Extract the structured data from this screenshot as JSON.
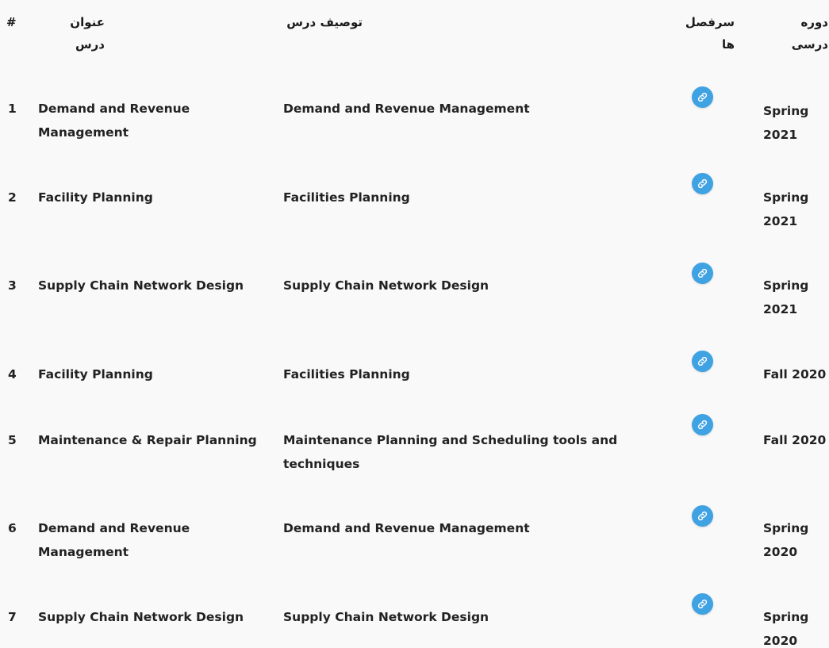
{
  "table": {
    "headers": {
      "num": "#",
      "title": "عنوان درس",
      "description": "توصیف درس",
      "syllabus": "سرفصل ها",
      "term": "دوره درسی"
    },
    "rows": [
      {
        "num": "1",
        "title": "Demand and Revenue Management",
        "description": "Demand and Revenue Management",
        "term": "Spring 2021"
      },
      {
        "num": "2",
        "title": "Facility Planning",
        "description": "Facilities Planning",
        "term": "Spring 2021"
      },
      {
        "num": "3",
        "title": "Supply Chain Network Design",
        "description": "Supply Chain Network Design",
        "term": "Spring 2021"
      },
      {
        "num": "4",
        "title": "Facility Planning",
        "description": "Facilities Planning",
        "term": "Fall 2020"
      },
      {
        "num": "5",
        "title": "Maintenance & Repair Planning",
        "description": "Maintenance Planning and Scheduling tools and techniques",
        "term": "Fall 2020"
      },
      {
        "num": "6",
        "title": "Demand and Revenue Management",
        "description": "Demand and Revenue Management",
        "term": "Spring 2020"
      },
      {
        "num": "7",
        "title": "Supply Chain Network Design",
        "description": "Supply Chain Network Design",
        "term": "Spring 2020"
      }
    ],
    "syllabus_icon": "link-icon"
  },
  "colors": {
    "background": "#f9f9f9",
    "link_button": "#3fa2e3",
    "text": "#222222"
  }
}
